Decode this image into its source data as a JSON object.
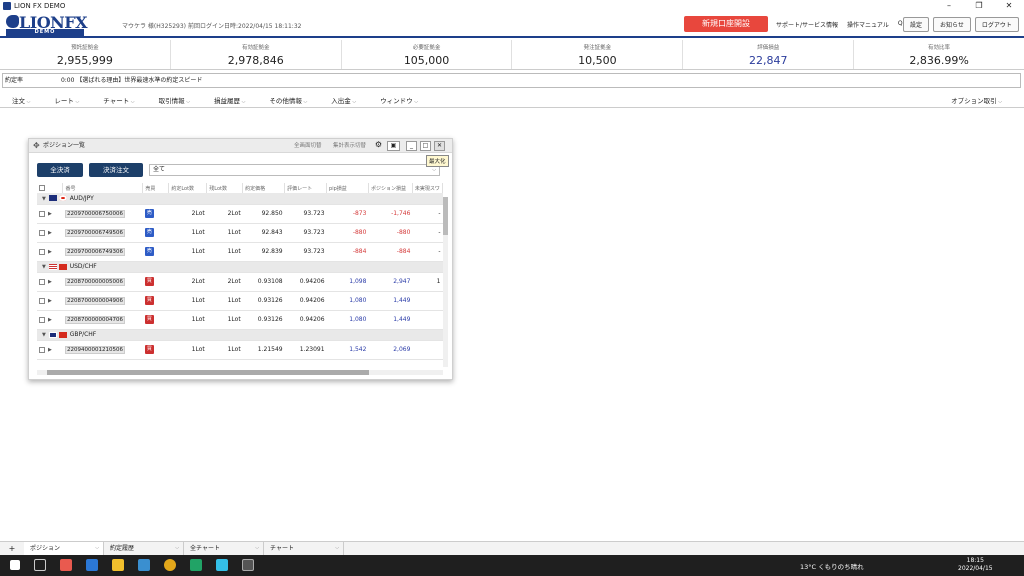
{
  "window": {
    "title": "LION FX DEMO",
    "icon": "app-icon"
  },
  "header": {
    "logo_text": "LIONFX",
    "logo_sub": "DEMO",
    "account": "マウケラ 様(H325293)",
    "last_login": "前回ログイン日時:2022/04/15 18:11:32",
    "open_account": "新規口座開設",
    "links": [
      "サポート/サービス情報",
      "操作マニュアル",
      "Q&A"
    ],
    "buttons": [
      "設定",
      "お知らせ",
      "ログアウト"
    ]
  },
  "summary": [
    {
      "label": "預託証拠金",
      "value": "2,955,999",
      "color": "#222222"
    },
    {
      "label": "有効証拠金",
      "value": "2,978,846",
      "color": "#222222"
    },
    {
      "label": "必要証拠金",
      "value": "105,000",
      "color": "#222222"
    },
    {
      "label": "発注証拠金",
      "value": "10,500",
      "color": "#222222"
    },
    {
      "label": "評価損益",
      "value": "22,847",
      "color": "#2b3c9c"
    },
    {
      "label": "有効比率",
      "value": "2,836.99%",
      "color": "#222222"
    }
  ],
  "ticker": {
    "label": "約定率",
    "time": "0:00",
    "text": "【選ばれる理由】世界最速水準の約定スピード"
  },
  "menu": [
    "注文",
    "レート",
    "チャート",
    "取引情報",
    "損益履歴",
    "その他情報",
    "入出金",
    "ウィンドウ"
  ],
  "menu_right": "オプション取引",
  "panel": {
    "title": "ポジション一覧",
    "toggle1": "全画面切替",
    "toggle2": "集計表示切替",
    "tooltip": "最大化",
    "settle_all": "全決済",
    "settle_order": "決済注文",
    "filter": "全て",
    "columns": [
      "番号",
      "売買",
      "約定Lot数",
      "残Lot数",
      "約定価格",
      "評価レート",
      "pip損益",
      "ポジション損益",
      "未実現スワ"
    ],
    "groups": [
      {
        "pair": "AUD/JPY",
        "rows": [
          {
            "id": "2209700006750006",
            "side": "売",
            "lots": "2Lot",
            "remaining": "2Lot",
            "price": "92.850",
            "rate": "93.723",
            "pip": "-873",
            "pl": "-1,746",
            "swap": "-"
          },
          {
            "id": "2209700006749506",
            "side": "売",
            "lots": "1Lot",
            "remaining": "1Lot",
            "price": "92.843",
            "rate": "93.723",
            "pip": "-880",
            "pl": "-880",
            "swap": "-"
          },
          {
            "id": "2209700006749306",
            "side": "売",
            "lots": "1Lot",
            "remaining": "1Lot",
            "price": "92.839",
            "rate": "93.723",
            "pip": "-884",
            "pl": "-884",
            "swap": "-"
          }
        ]
      },
      {
        "pair": "USD/CHF",
        "rows": [
          {
            "id": "2208700000005006",
            "side": "買",
            "lots": "2Lot",
            "remaining": "2Lot",
            "price": "0.93108",
            "rate": "0.94206",
            "pip": "1,098",
            "pl": "2,947",
            "swap": "1"
          },
          {
            "id": "2208700000004906",
            "side": "買",
            "lots": "1Lot",
            "remaining": "1Lot",
            "price": "0.93126",
            "rate": "0.94206",
            "pip": "1,080",
            "pl": "1,449",
            "swap": ""
          },
          {
            "id": "2208700000004706",
            "side": "買",
            "lots": "1Lot",
            "remaining": "1Lot",
            "price": "0.93126",
            "rate": "0.94206",
            "pip": "1,080",
            "pl": "1,449",
            "swap": ""
          }
        ]
      },
      {
        "pair": "GBP/CHF",
        "rows": [
          {
            "id": "2209400001210506",
            "side": "買",
            "lots": "1Lot",
            "remaining": "1Lot",
            "price": "1.21549",
            "rate": "1.23091",
            "pip": "1,542",
            "pl": "2,069",
            "swap": ""
          }
        ]
      }
    ]
  },
  "tabs": [
    "ポジション",
    "約定履歴",
    "全チャート",
    "チャート"
  ],
  "taskbar": {
    "weather": "13°C くもりのち晴れ",
    "time": "18:15",
    "date": "2022/04/15"
  }
}
